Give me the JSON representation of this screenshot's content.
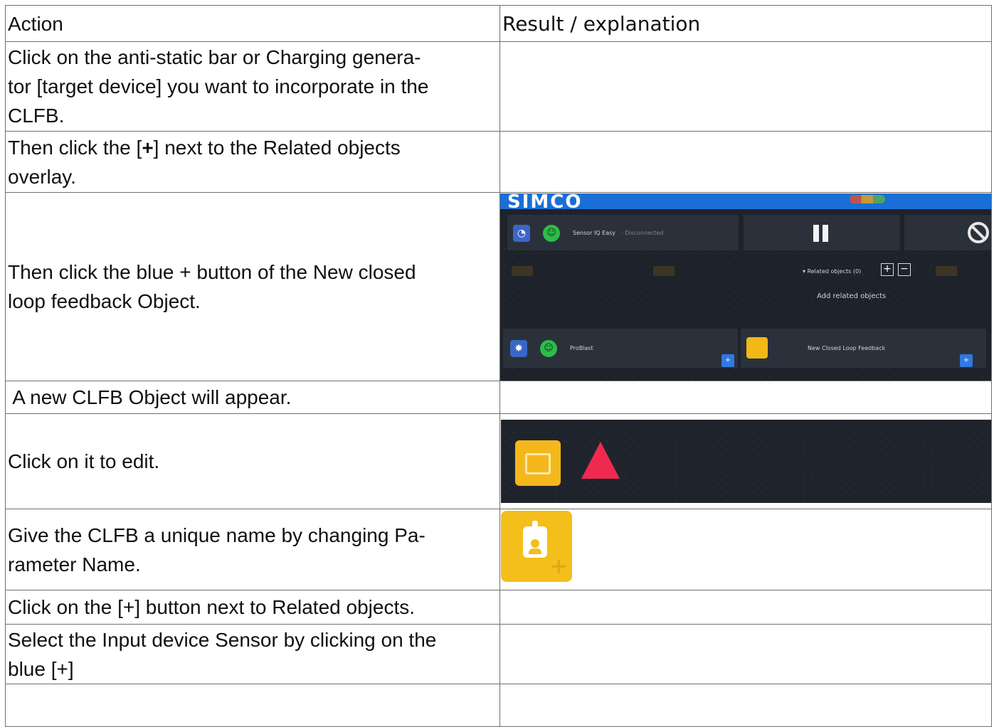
{
  "header": {
    "col_action": "Action",
    "col_result": "Result / explanation"
  },
  "rows": [
    {
      "action_lines": [
        "Click on the anti-static bar or Charging genera-",
        "tor [target device] you want to incorporate in the",
        "CLFB."
      ]
    },
    {
      "action_pre": "Then click the [",
      "action_bold": "+",
      "action_post": "] next to the Related objects",
      "action_line2": "overlay."
    },
    {
      "action_lines": [
        "Then click the blue + button of the New closed",
        "loop feedback Object."
      ]
    },
    {
      "action": " A new CLFB Object will appear."
    },
    {
      "action": "Click on it to edit."
    },
    {
      "action_lines": [
        "Give the CLFB a unique name by changing Pa-",
        "rameter Name."
      ]
    },
    {
      "action": "Click on the [+] button next to Related objects."
    },
    {
      "action_lines": [
        "Select the Input device Sensor by clicking on the",
        "blue [+]"
      ]
    },
    {
      "action": ""
    }
  ],
  "screenshot1": {
    "logo": "SIMCO",
    "sensor_label": "Sensor IQ Easy",
    "sensor_sub": "· Disconnected",
    "related_objects": "Related objects (0)",
    "plus": "+",
    "minus": "−",
    "add_related": "Add related objects",
    "left_item": "ProBlast",
    "right_item": "New Closed Loop Feedback",
    "blue_plus": "+"
  }
}
